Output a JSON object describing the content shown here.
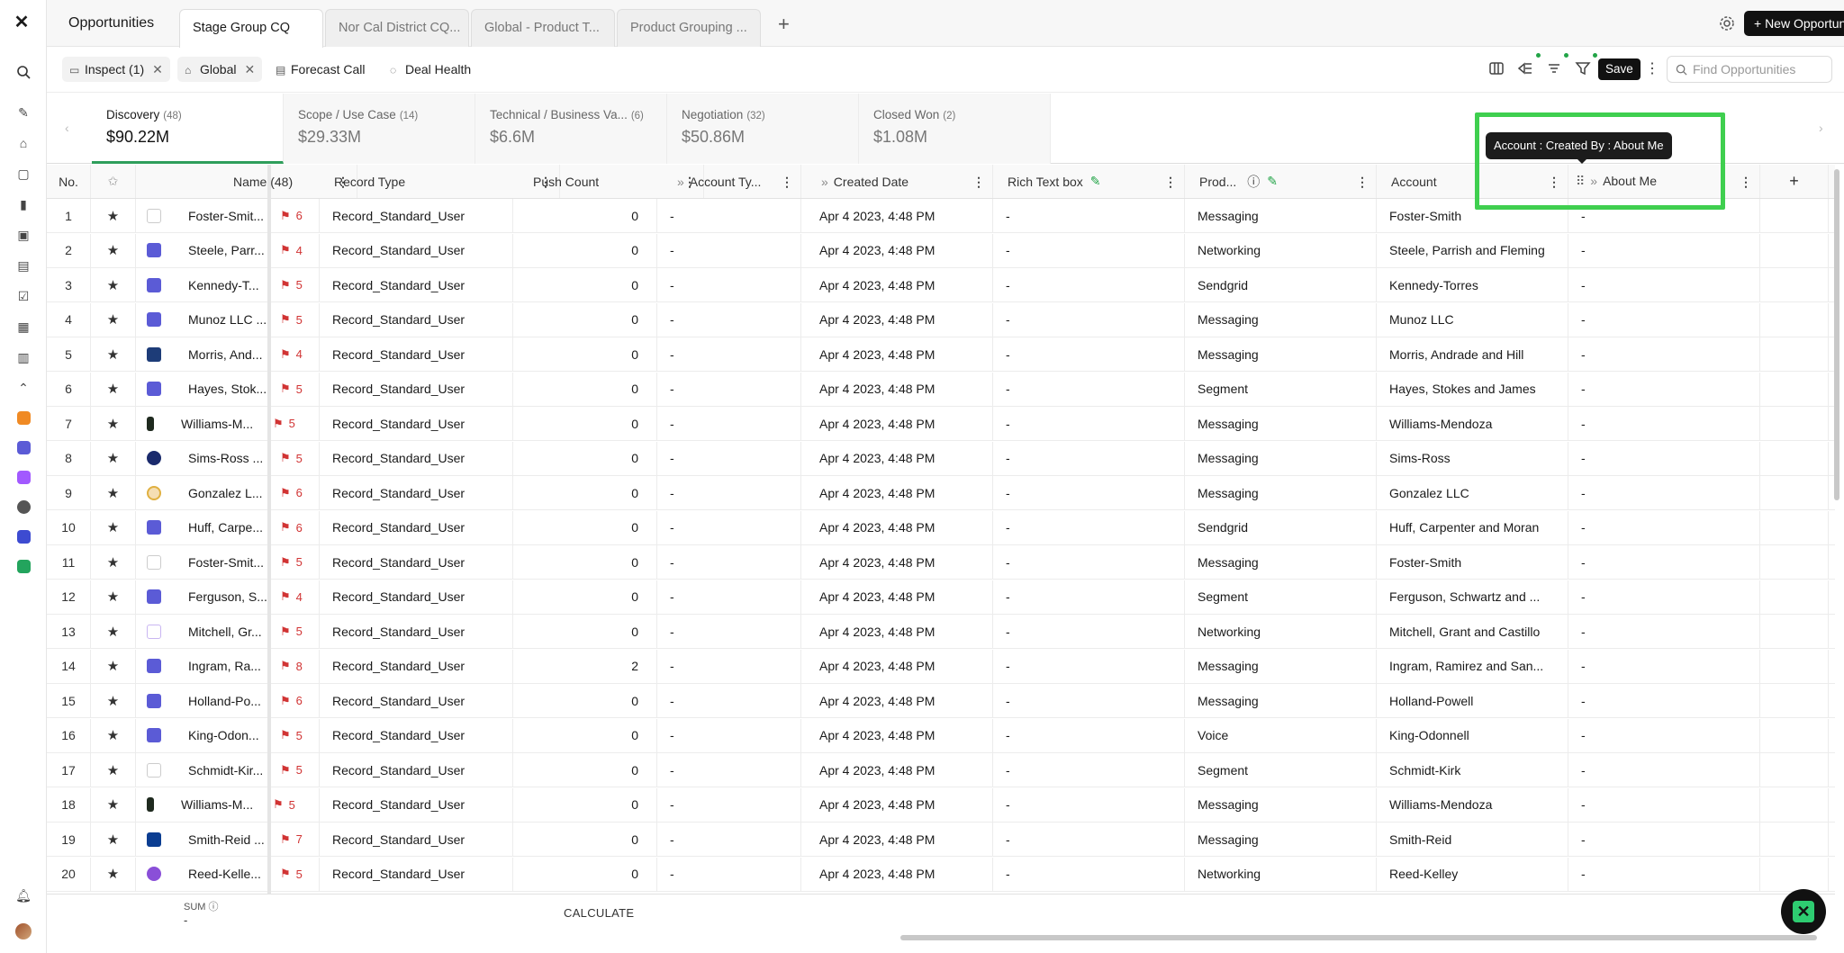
{
  "app": {
    "logo": "✕"
  },
  "header": {
    "title": "Opportunities",
    "tabs": [
      {
        "label": "Stage Group CQ"
      },
      {
        "label": "Nor Cal District CQ..."
      },
      {
        "label": "Global - Product T..."
      },
      {
        "label": "Product Grouping ..."
      }
    ],
    "new_button": "+ New Opportunity"
  },
  "filters": {
    "chips": [
      {
        "label": "Inspect (1)"
      },
      {
        "label": "Global"
      },
      {
        "label": "Forecast Call"
      },
      {
        "label": "Deal Health"
      }
    ],
    "save_label": "Save",
    "search_placeholder": "Find Opportunities"
  },
  "stages": [
    {
      "name": "Discovery",
      "count": "(48)",
      "value": "$90.22M"
    },
    {
      "name": "Scope / Use Case",
      "count": "(14)",
      "value": "$29.33M"
    },
    {
      "name": "Technical / Business Va...",
      "count": "(6)",
      "value": "$6.6M"
    },
    {
      "name": "Negotiation",
      "count": "(32)",
      "value": "$50.86M"
    },
    {
      "name": "Closed Won",
      "count": "(2)",
      "value": "$1.08M"
    }
  ],
  "tooltip": "Account : Created By : About Me",
  "columns": {
    "no": "No.",
    "name": "Name (48)",
    "record_type": "Record Type",
    "push_count": "Push Count",
    "account_type": "Account Ty...",
    "created_date": "Created Date",
    "rich_text": "Rich Text box",
    "product": "Prod...",
    "account": "Account",
    "about_me": "About Me"
  },
  "rows": [
    {
      "no": "1",
      "name": "Foster-Smit...",
      "flag": "6",
      "record": "Record_Standard_User",
      "push": "0",
      "acct_type": "-",
      "created": "Apr 4 2023, 4:48 PM",
      "rich": "-",
      "product": "Messaging",
      "account": "Foster-Smith",
      "about": "-",
      "av": "dash"
    },
    {
      "no": "2",
      "name": "Steele, Parr...",
      "flag": "4",
      "record": "Record_Standard_User",
      "push": "0",
      "acct_type": "-",
      "created": "Apr 4 2023, 4:48 PM",
      "rich": "-",
      "product": "Networking",
      "account": "Steele, Parrish and Fleming",
      "about": "-",
      "av": "bldg"
    },
    {
      "no": "3",
      "name": "Kennedy-T...",
      "flag": "5",
      "record": "Record_Standard_User",
      "push": "0",
      "acct_type": "-",
      "created": "Apr 4 2023, 4:48 PM",
      "rich": "-",
      "product": "Sendgrid",
      "account": "Kennedy-Torres",
      "about": "-",
      "av": "bldg"
    },
    {
      "no": "4",
      "name": "Munoz LLC ...",
      "flag": "5",
      "record": "Record_Standard_User",
      "push": "0",
      "acct_type": "-",
      "created": "Apr 4 2023, 4:48 PM",
      "rich": "-",
      "product": "Messaging",
      "account": "Munoz LLC",
      "about": "-",
      "av": "bldg"
    },
    {
      "no": "5",
      "name": "Morris, And...",
      "flag": "4",
      "record": "Record_Standard_User",
      "push": "0",
      "acct_type": "-",
      "created": "Apr 4 2023, 4:48 PM",
      "rich": "-",
      "product": "Messaging",
      "account": "Morris, Andrade and Hill",
      "about": "-",
      "av": "navy"
    },
    {
      "no": "6",
      "name": "Hayes, Stok...",
      "flag": "5",
      "record": "Record_Standard_User",
      "push": "0",
      "acct_type": "-",
      "created": "Apr 4 2023, 4:48 PM",
      "rich": "-",
      "product": "Segment",
      "account": "Hayes, Stokes and James",
      "about": "-",
      "av": "bldg"
    },
    {
      "no": "7",
      "name": "Williams-M...",
      "flag": "5",
      "record": "Record_Standard_User",
      "push": "0",
      "acct_type": "-",
      "created": "Apr 4 2023, 4:48 PM",
      "rich": "-",
      "product": "Messaging",
      "account": "Williams-Mendoza",
      "about": "-",
      "av": "dark"
    },
    {
      "no": "8",
      "name": "Sims-Ross ...",
      "flag": "5",
      "record": "Record_Standard_User",
      "push": "0",
      "acct_type": "-",
      "created": "Apr 4 2023, 4:48 PM",
      "rich": "-",
      "product": "Messaging",
      "account": "Sims-Ross",
      "about": "-",
      "av": "sun"
    },
    {
      "no": "9",
      "name": "Gonzalez L...",
      "flag": "6",
      "record": "Record_Standard_User",
      "push": "0",
      "acct_type": "-",
      "created": "Apr 4 2023, 4:48 PM",
      "rich": "-",
      "product": "Messaging",
      "account": "Gonzalez LLC",
      "about": "-",
      "av": "ring"
    },
    {
      "no": "10",
      "name": "Huff, Carpe...",
      "flag": "6",
      "record": "Record_Standard_User",
      "push": "0",
      "acct_type": "-",
      "created": "Apr 4 2023, 4:48 PM",
      "rich": "-",
      "product": "Sendgrid",
      "account": "Huff, Carpenter and Moran",
      "about": "-",
      "av": "bldg"
    },
    {
      "no": "11",
      "name": "Foster-Smit...",
      "flag": "5",
      "record": "Record_Standard_User",
      "push": "0",
      "acct_type": "-",
      "created": "Apr 4 2023, 4:48 PM",
      "rich": "-",
      "product": "Messaging",
      "account": "Foster-Smith",
      "about": "-",
      "av": "dash"
    },
    {
      "no": "12",
      "name": "Ferguson, S...",
      "flag": "4",
      "record": "Record_Standard_User",
      "push": "0",
      "acct_type": "-",
      "created": "Apr 4 2023, 4:48 PM",
      "rich": "-",
      "product": "Segment",
      "account": "Ferguson, Schwartz and ...",
      "about": "-",
      "av": "bldg"
    },
    {
      "no": "13",
      "name": "Mitchell, Gr...",
      "flag": "5",
      "record": "Record_Standard_User",
      "push": "0",
      "acct_type": "-",
      "created": "Apr 4 2023, 4:48 PM",
      "rich": "-",
      "product": "Networking",
      "account": "Mitchell, Grant and Castillo",
      "about": "-",
      "av": "purp"
    },
    {
      "no": "14",
      "name": "Ingram, Ra...",
      "flag": "8",
      "record": "Record_Standard_User",
      "push": "2",
      "acct_type": "-",
      "created": "Apr 4 2023, 4:48 PM",
      "rich": "-",
      "product": "Messaging",
      "account": "Ingram, Ramirez and San...",
      "about": "-",
      "av": "bldg"
    },
    {
      "no": "15",
      "name": "Holland-Po...",
      "flag": "6",
      "record": "Record_Standard_User",
      "push": "0",
      "acct_type": "-",
      "created": "Apr 4 2023, 4:48 PM",
      "rich": "-",
      "product": "Messaging",
      "account": "Holland-Powell",
      "about": "-",
      "av": "bldg"
    },
    {
      "no": "16",
      "name": "King-Odon...",
      "flag": "5",
      "record": "Record_Standard_User",
      "push": "0",
      "acct_type": "-",
      "created": "Apr 4 2023, 4:48 PM",
      "rich": "-",
      "product": "Voice",
      "account": "King-Odonnell",
      "about": "-",
      "av": "bldg"
    },
    {
      "no": "17",
      "name": "Schmidt-Kir...",
      "flag": "5",
      "record": "Record_Standard_User",
      "push": "0",
      "acct_type": "-",
      "created": "Apr 4 2023, 4:48 PM",
      "rich": "-",
      "product": "Segment",
      "account": "Schmidt-Kirk",
      "about": "-",
      "av": "dash"
    },
    {
      "no": "18",
      "name": "Williams-M...",
      "flag": "5",
      "record": "Record_Standard_User",
      "push": "0",
      "acct_type": "-",
      "created": "Apr 4 2023, 4:48 PM",
      "rich": "-",
      "product": "Messaging",
      "account": "Williams-Mendoza",
      "about": "-",
      "av": "dark"
    },
    {
      "no": "19",
      "name": "Smith-Reid ...",
      "flag": "7",
      "record": "Record_Standard_User",
      "push": "0",
      "acct_type": "-",
      "created": "Apr 4 2023, 4:48 PM",
      "rich": "-",
      "product": "Messaging",
      "account": "Smith-Reid",
      "about": "-",
      "av": "win"
    },
    {
      "no": "20",
      "name": "Reed-Kelle...",
      "flag": "5",
      "record": "Record_Standard_User",
      "push": "0",
      "acct_type": "-",
      "created": "Apr 4 2023, 4:48 PM",
      "rich": "-",
      "product": "Networking",
      "account": "Reed-Kelley",
      "about": "-",
      "av": "pink"
    }
  ],
  "footer": {
    "sum_label": "SUM ⓘ",
    "sum_value": "-",
    "calculate": "CALCULATE"
  },
  "colors": {
    "accent": "#2e9e5b",
    "highlight": "#3fcf4f",
    "flag": "#d13434",
    "avatar_blue": "#5b5bd6"
  }
}
